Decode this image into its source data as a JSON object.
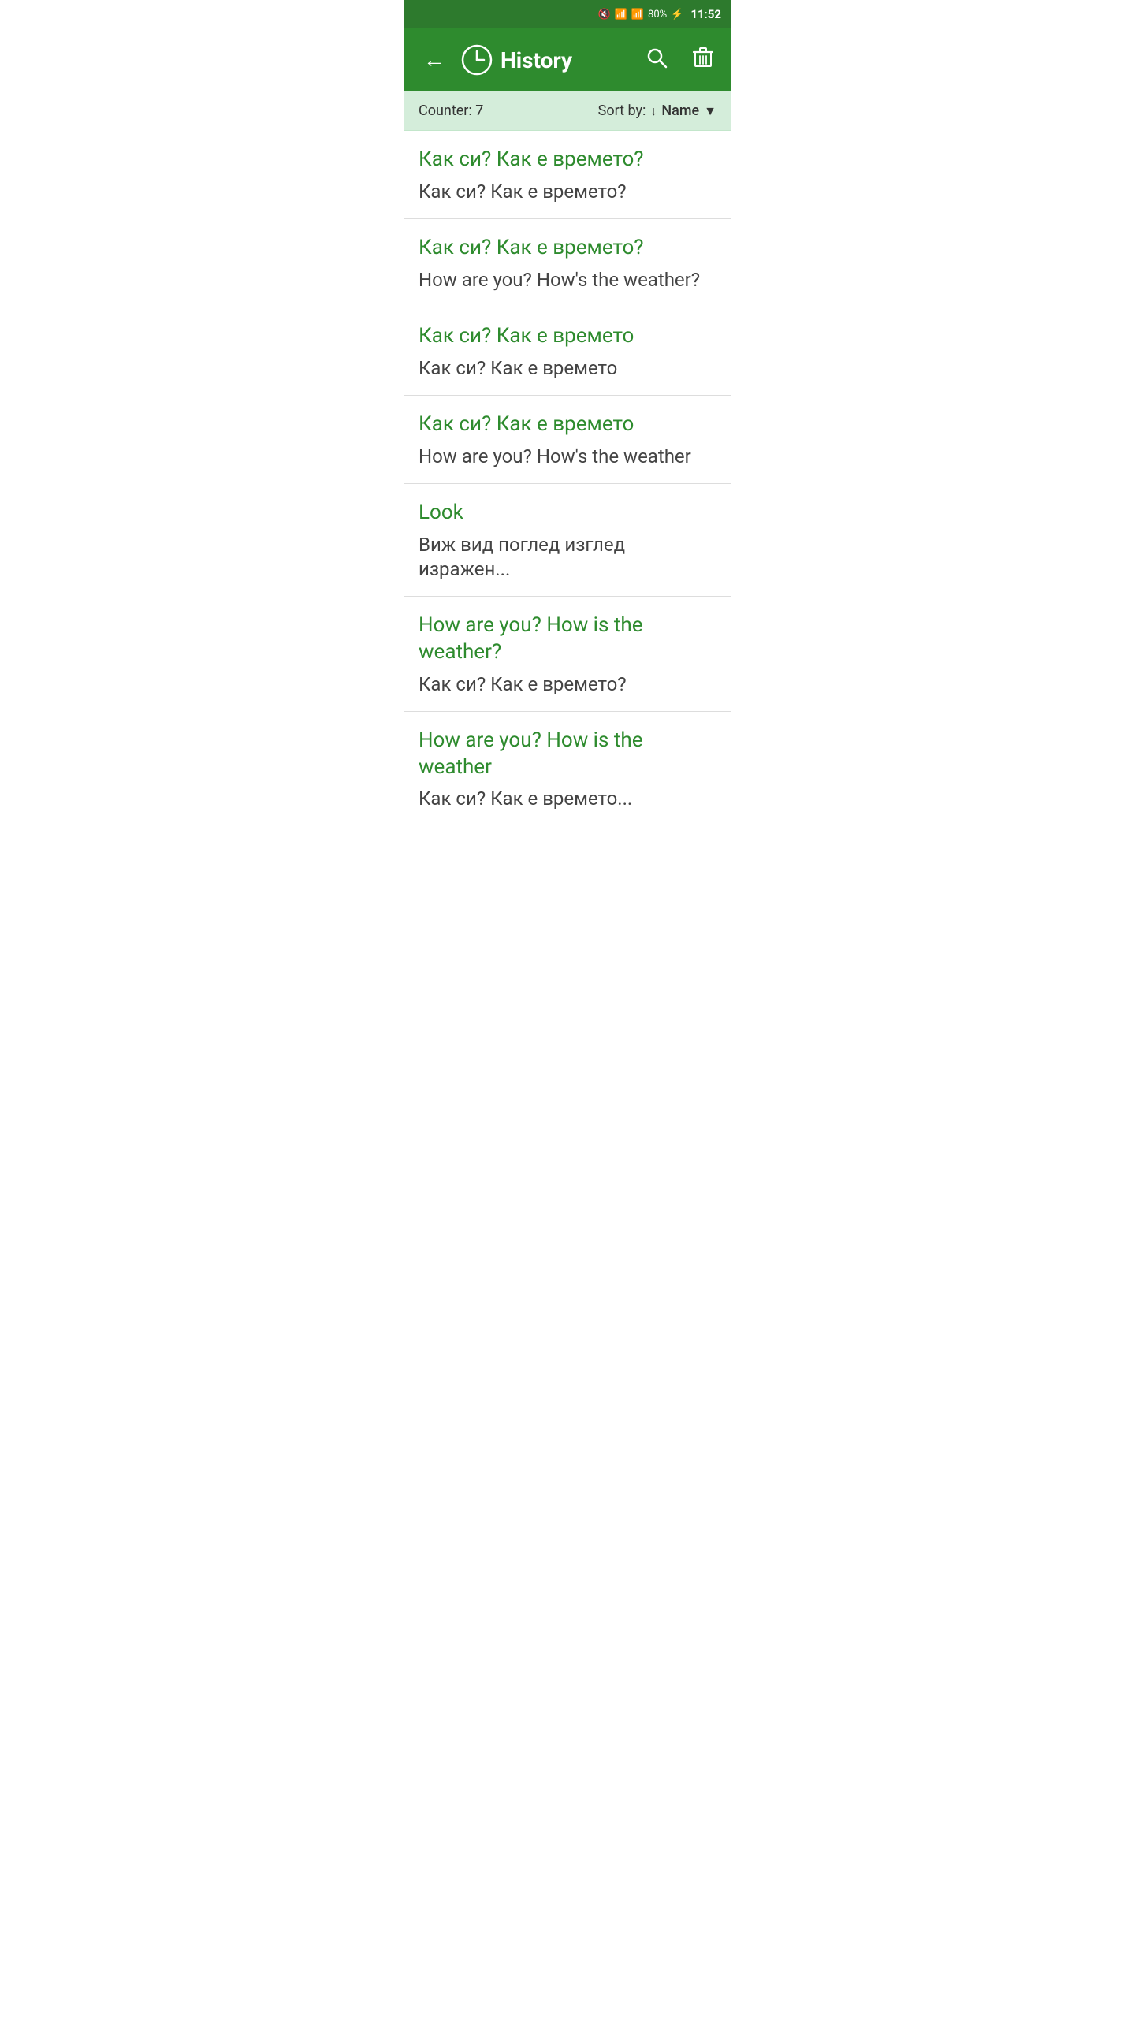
{
  "statusBar": {
    "battery": "80%",
    "time": "11:52",
    "batteryIcon": "🔋",
    "signalIcon": "📶",
    "wifiIcon": "📡"
  },
  "appBar": {
    "backLabel": "←",
    "title": "History",
    "searchLabel": "🔍",
    "deleteLabel": "🗑"
  },
  "subheader": {
    "counter": "Counter: 7",
    "sortLabel": "Sort by:",
    "sortValue": "Name"
  },
  "historyItems": [
    {
      "primary": "Как си? Как е времето?",
      "secondary": "Как си? Как е времето?"
    },
    {
      "primary": "Как си? Как е времето?",
      "secondary": "How are you? How's the weather?"
    },
    {
      "primary": "Как си? Как е времето",
      "secondary": "Как си? Как е времето"
    },
    {
      "primary": "Как си? Как е времето",
      "secondary": "How are you? How's the weather"
    },
    {
      "primary": "Look",
      "secondary": "Виж  вид поглед изглед изражен..."
    },
    {
      "primary": "How are you? How is the weather?",
      "secondary": "Как си? Как е времето?"
    },
    {
      "primary": "How are you? How is the weather",
      "secondary": "Как си? Как е времето..."
    }
  ]
}
